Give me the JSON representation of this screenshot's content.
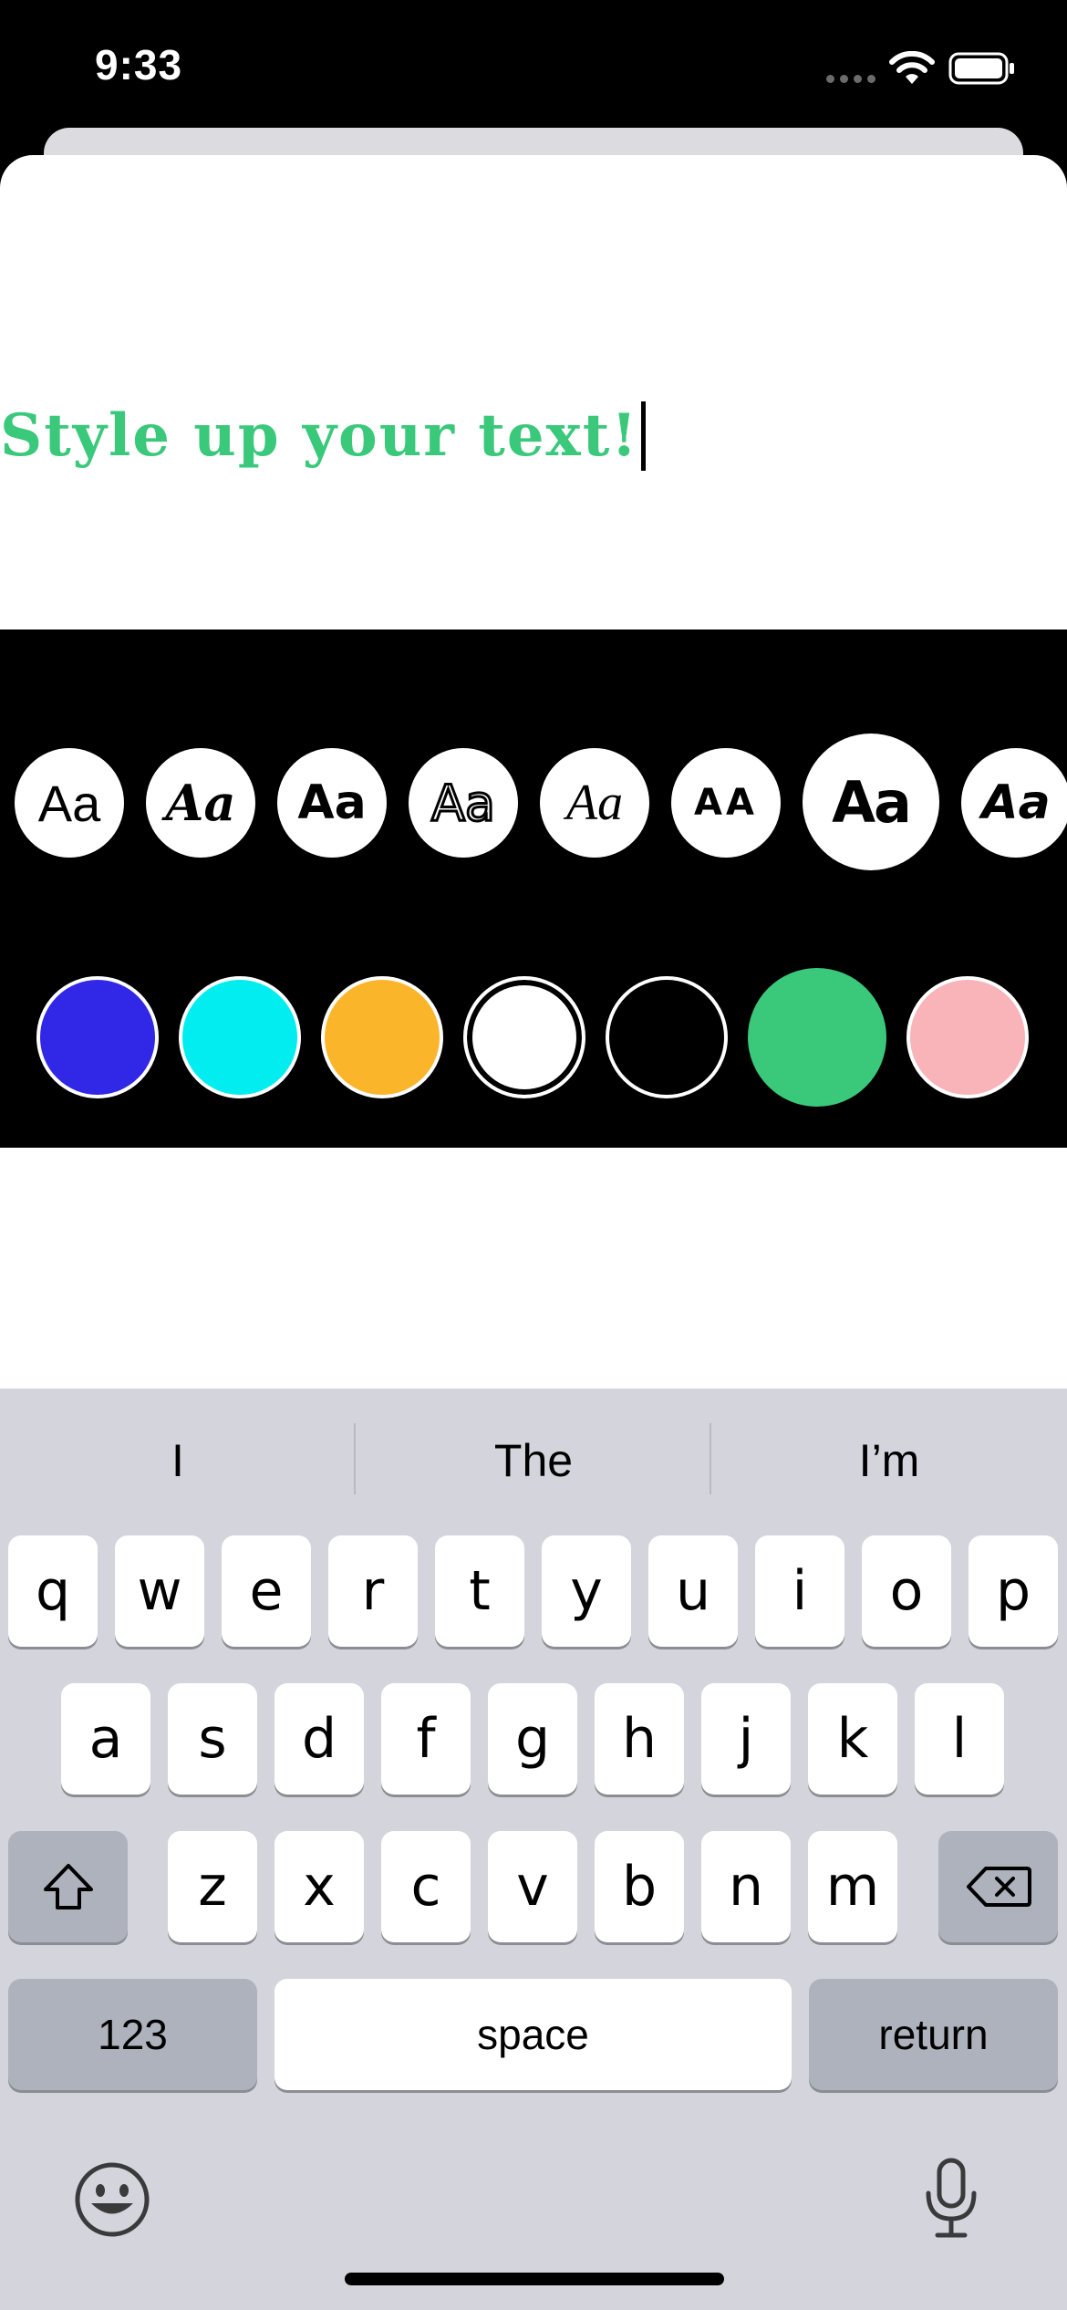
{
  "status_bar": {
    "time": "9:33"
  },
  "editor": {
    "text": "Style up your text!",
    "color": "#3ac87b"
  },
  "font_options": [
    {
      "glyph": "Aa",
      "style": "sans"
    },
    {
      "glyph": "Aa",
      "style": "serif-italic"
    },
    {
      "glyph": "Aa",
      "style": "rounded-bold"
    },
    {
      "glyph": "Aa",
      "style": "rough"
    },
    {
      "glyph": "Aa",
      "style": "script"
    },
    {
      "glyph": "AA",
      "style": "wide-caps"
    },
    {
      "glyph": "Aa",
      "style": "heavy-selected"
    },
    {
      "glyph": "Aa",
      "style": "condensed-bold"
    }
  ],
  "color_options": [
    "#3127e6",
    "#02edef",
    "#fbb52b",
    "#ffffff",
    "#000000",
    "#3ac87b",
    "#f8b4b8"
  ],
  "selected_color": "#3ac87b",
  "keyboard": {
    "suggestions": [
      "I",
      "The",
      "I’m"
    ],
    "row1": [
      "q",
      "w",
      "e",
      "r",
      "t",
      "y",
      "u",
      "i",
      "o",
      "p"
    ],
    "row2": [
      "a",
      "s",
      "d",
      "f",
      "g",
      "h",
      "j",
      "k",
      "l"
    ],
    "row3": [
      "z",
      "x",
      "c",
      "v",
      "b",
      "n",
      "m"
    ],
    "numbers_label": "123",
    "space_label": "space",
    "return_label": "return"
  }
}
